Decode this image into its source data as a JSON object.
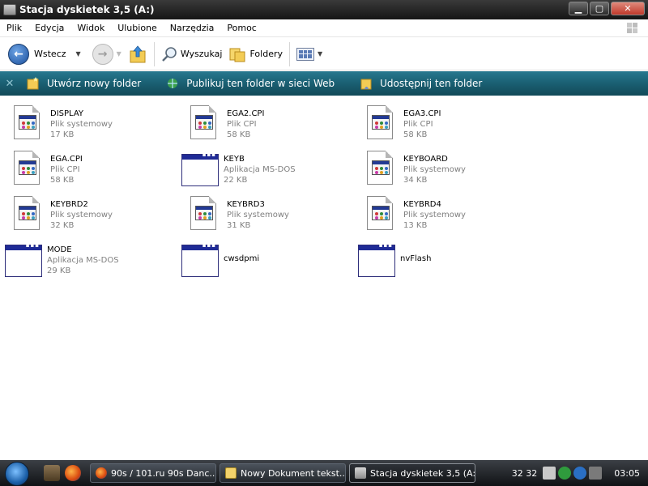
{
  "window": {
    "title": "Stacja dyskietek 3,5 (A:)"
  },
  "menu": [
    "Plik",
    "Edycja",
    "Widok",
    "Ulubione",
    "Narzędzia",
    "Pomoc"
  ],
  "toolbar": {
    "back_label": "Wstecz",
    "search_label": "Wyszukaj",
    "folders_label": "Foldery"
  },
  "tasks": {
    "new_folder": "Utwórz nowy folder",
    "publish": "Publikuj ten folder w sieci Web",
    "share": "Udostępnij ten folder"
  },
  "files": [
    {
      "name": "DISPLAY",
      "type": "Plik systemowy",
      "size": "17 KB",
      "icon": "system-file-icon"
    },
    {
      "name": "EGA2.CPI",
      "type": "Plik CPI",
      "size": "58 KB",
      "icon": "system-file-icon"
    },
    {
      "name": "EGA3.CPI",
      "type": "Plik CPI",
      "size": "58 KB",
      "icon": "system-file-icon"
    },
    {
      "name": "EGA.CPI",
      "type": "Plik CPI",
      "size": "58 KB",
      "icon": "system-file-icon"
    },
    {
      "name": "KEYB",
      "type": "Aplikacja MS-DOS",
      "size": "22 KB",
      "icon": "dos-app-icon"
    },
    {
      "name": "KEYBOARD",
      "type": "Plik systemowy",
      "size": "34 KB",
      "icon": "system-file-icon"
    },
    {
      "name": "KEYBRD2",
      "type": "Plik systemowy",
      "size": "32 KB",
      "icon": "system-file-icon"
    },
    {
      "name": "KEYBRD3",
      "type": "Plik systemowy",
      "size": "31 KB",
      "icon": "system-file-icon"
    },
    {
      "name": "KEYBRD4",
      "type": "Plik systemowy",
      "size": "13 KB",
      "icon": "system-file-icon"
    },
    {
      "name": "MODE",
      "type": "Aplikacja MS-DOS",
      "size": "29 KB",
      "icon": "dos-app-icon"
    },
    {
      "name": "cwsdpmi",
      "type": "",
      "size": "",
      "icon": "dos-app-icon"
    },
    {
      "name": "nvFlash",
      "type": "",
      "size": "",
      "icon": "dos-app-icon"
    }
  ],
  "taskbar": {
    "buttons": [
      {
        "label": "90s / 101.ru 90s Danc..."
      },
      {
        "label": "Nowy Dokument tekst..."
      },
      {
        "label": "Stacja dyskietek 3,5 (A:)"
      }
    ],
    "tray_text": "32 32",
    "clock": "03:05"
  },
  "colors": {
    "task_pane": "#1a5f72",
    "title_bar": "#151515",
    "taskbar": "#101215"
  }
}
